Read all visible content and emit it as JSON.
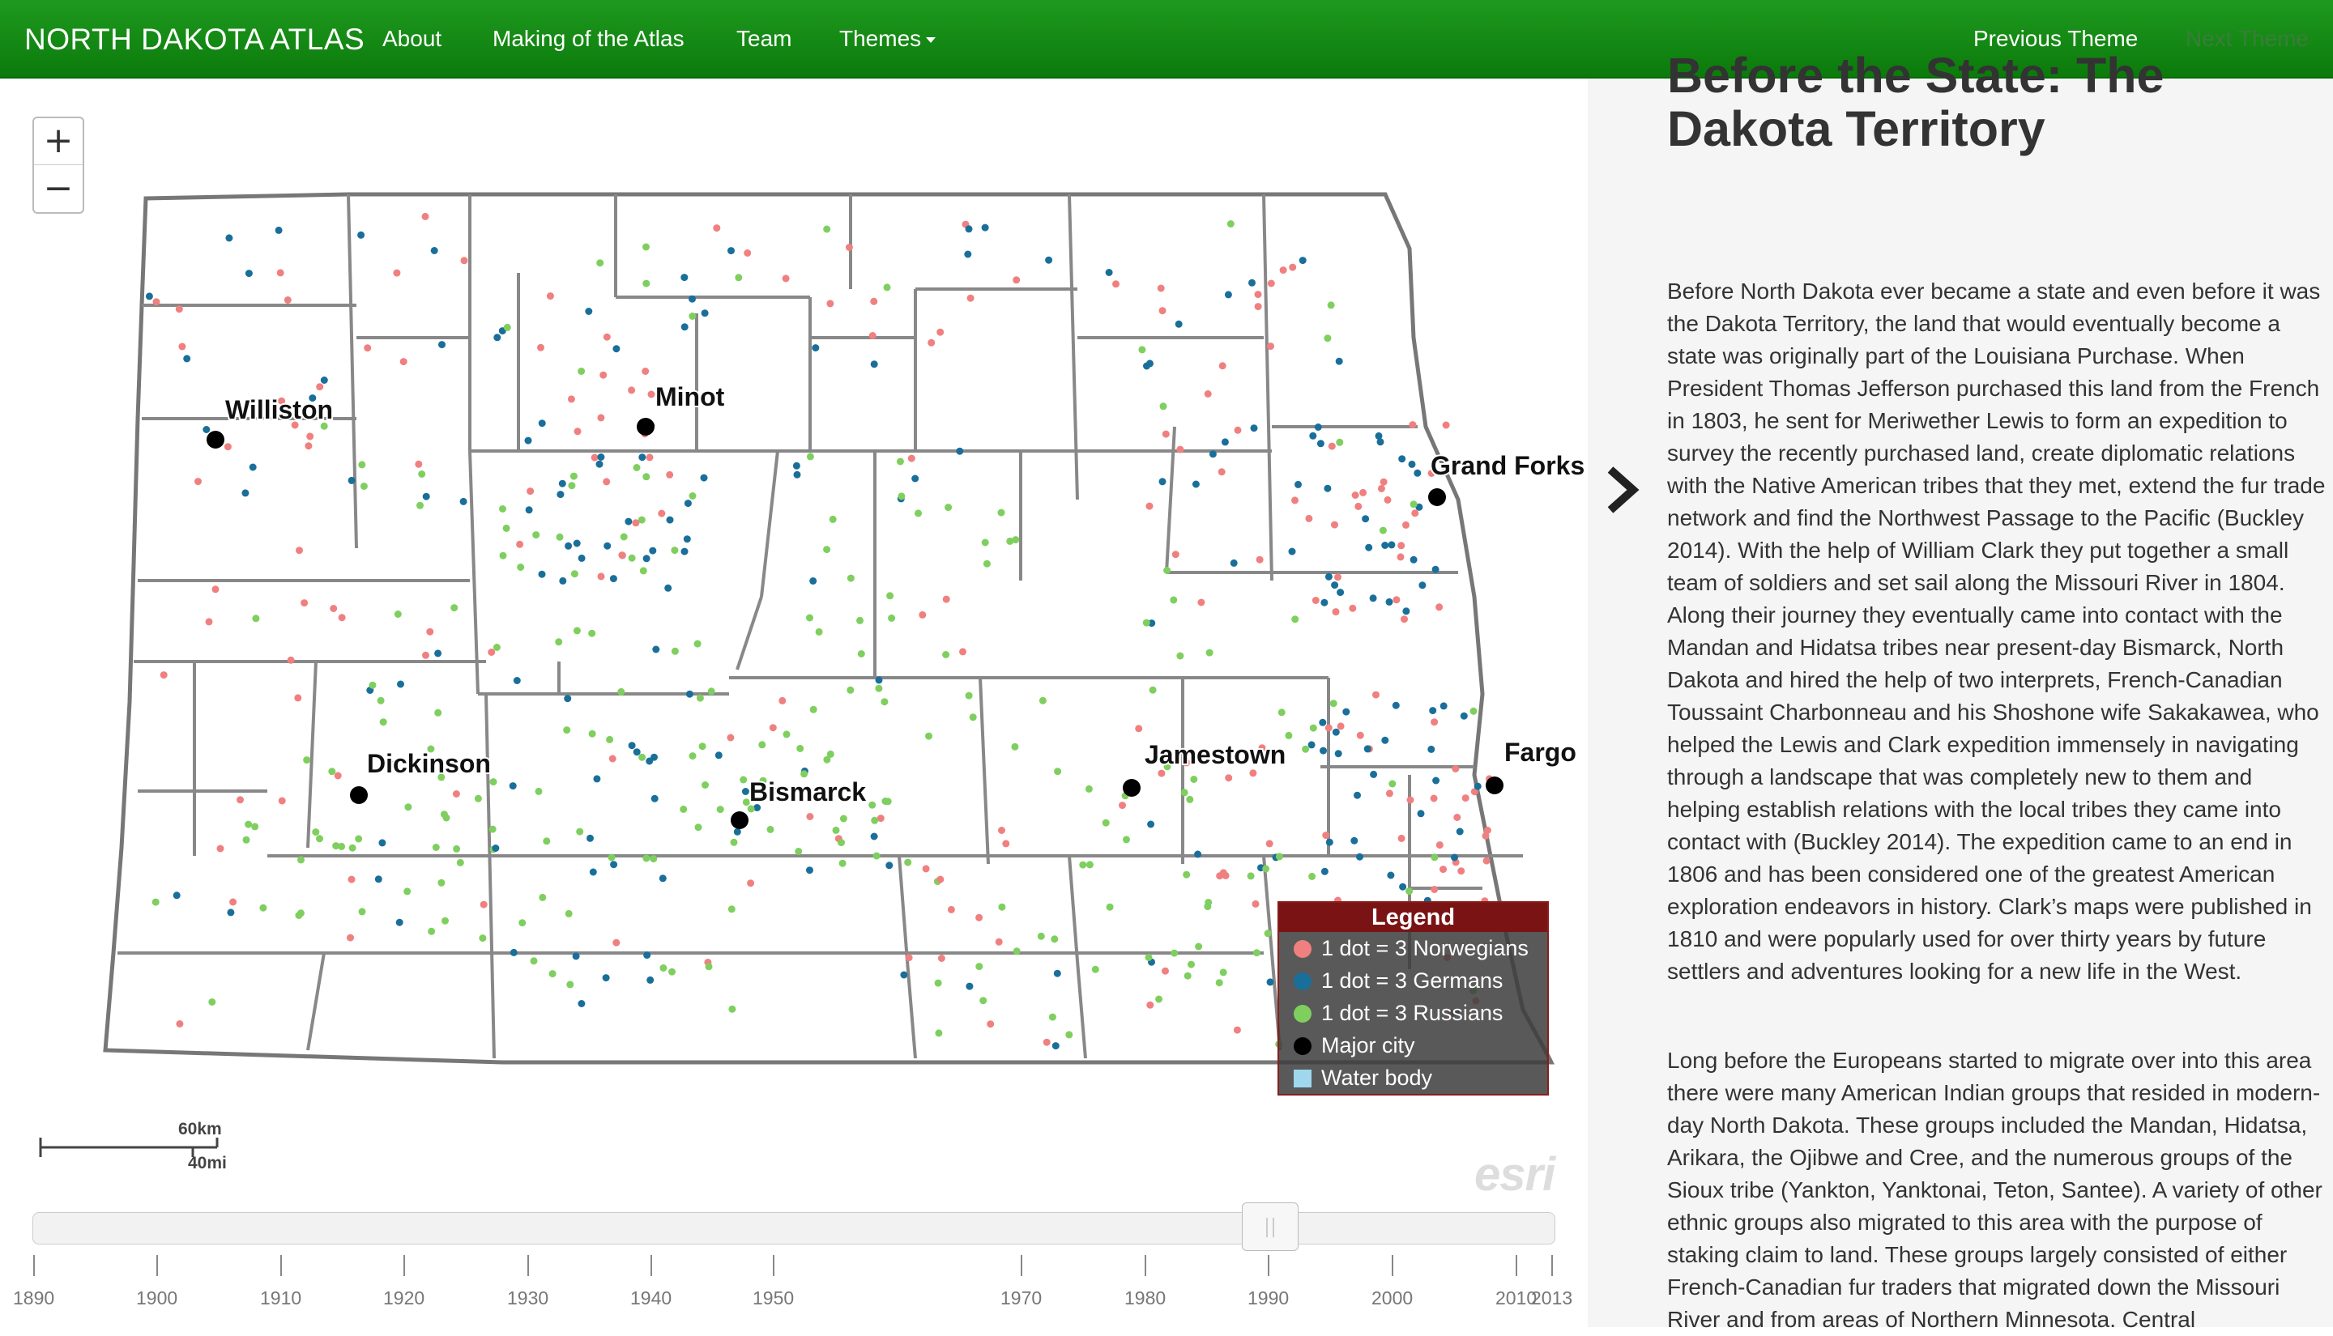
{
  "navbar": {
    "brand": "NORTH DAKOTA ATLAS",
    "links": [
      "About",
      "Making of the Atlas",
      "Team",
      "Themes"
    ],
    "prev": "Previous Theme",
    "next": "Next Theme"
  },
  "map": {
    "cities": [
      {
        "name": "Williston"
      },
      {
        "name": "Minot"
      },
      {
        "name": "Grand Forks"
      },
      {
        "name": "Dickinson"
      },
      {
        "name": "Bismarck"
      },
      {
        "name": "Jamestown"
      },
      {
        "name": "Fargo"
      }
    ],
    "scale": {
      "km": "60km",
      "mi": "40mi"
    },
    "attribution": "esri",
    "zoom_in": "+",
    "zoom_out": "−",
    "colors": {
      "norwegian": "#f08080",
      "german": "#1a6f9a",
      "russian": "#7fcf5f",
      "city": "#000000",
      "water": "#9fd8ee"
    }
  },
  "legend": {
    "title": "Legend",
    "items": [
      "1 dot = 3 Norwegians",
      "1 dot = 3 Germans",
      "1 dot = 3 Russians",
      "Major city",
      "Water body"
    ]
  },
  "timeline": {
    "labels": [
      "1890",
      "1900",
      "1910",
      "1920",
      "1930",
      "1940",
      "1950",
      "1970",
      "1980",
      "1990",
      "2000",
      "2010",
      "2013"
    ],
    "selected_year": "1990"
  },
  "sidebar": {
    "collapse_icon": "chevron-right-icon",
    "title": "Before the State: The Dakota Territory",
    "paragraphs": [
      "Before North Dakota ever became a state and even before it was the Dakota Territory, the land that would eventually become a state was originally part of the Louisiana Purchase. When President Thomas Jefferson purchased this land from the French in 1803, he sent for Meriwether Lewis to form an expedition to survey the recently purchased land, create diplomatic relations with the Native American tribes that they met, extend the fur trade network and find the Northwest Passage to the Pacific (Buckley 2014). With the help of William Clark they put together a small team of soldiers and set sail along the Missouri River in 1804. Along their journey they eventually came into contact with the Mandan and Hidatsa tribes near present-day Bismarck, North Dakota and hired the help of two interprets, French-Canadian Toussaint Charbonneau and his Shoshone wife Sakakawea, who helped the Lewis and Clark expedition immensely in navigating through a landscape that was completely new to them and helping establish relations with the local tribes they came into contact with (Buckley 2014). The expedition came to an end in 1806 and has been considered one of the greatest American exploration endeavors in history. Clark’s maps were published in 1810 and were popularly used for over thirty years by future settlers and adventures looking for a new life in the West.",
      "Long before the Europeans started to migrate over into this area there were many American Indian groups that resided in modern-day North Dakota. These groups included the Mandan, Hidatsa, Arikara, the Ojibwe and Cree, and the numerous groups of the Sioux tribe (Yankton, Yanktonai, Teton, Santee). A variety of other ethnic groups also migrated to this area with the purpose of staking claim to land. These groups largely consisted of either French-Canadian fur traders that migrated down the Missouri River and from areas of Northern Minnesota. Central"
    ]
  }
}
